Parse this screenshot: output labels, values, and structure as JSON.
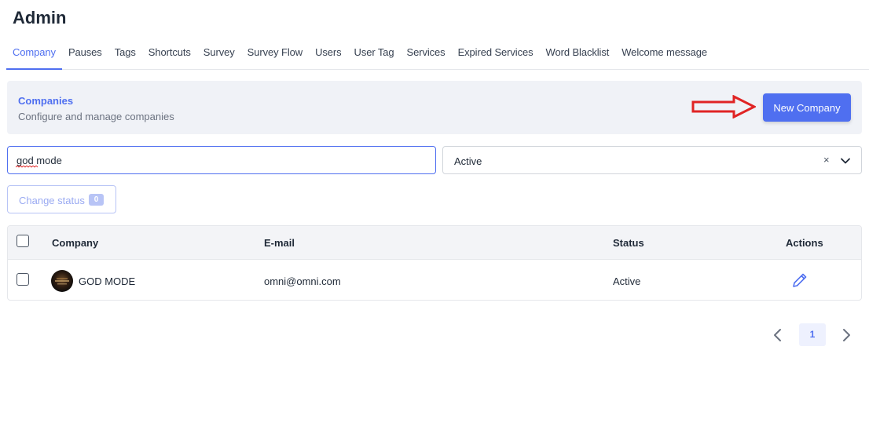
{
  "page": {
    "title": "Admin"
  },
  "tabs": [
    {
      "label": "Company",
      "active": true
    },
    {
      "label": "Pauses"
    },
    {
      "label": "Tags"
    },
    {
      "label": "Shortcuts"
    },
    {
      "label": "Survey"
    },
    {
      "label": "Survey Flow"
    },
    {
      "label": "Users"
    },
    {
      "label": "User Tag"
    },
    {
      "label": "Services"
    },
    {
      "label": "Expired Services"
    },
    {
      "label": "Word Blacklist"
    },
    {
      "label": "Welcome message"
    }
  ],
  "header": {
    "title": "Companies",
    "subtitle": "Configure and manage companies",
    "new_button": "New Company",
    "arrow_color": "#e02424"
  },
  "filters": {
    "search_value": "god mode",
    "status_value": "Active",
    "clear_icon": "×"
  },
  "bulk": {
    "change_status_label": "Change status",
    "selected_count": "0"
  },
  "table": {
    "columns": {
      "company": "Company",
      "email": "E-mail",
      "status": "Status",
      "actions": "Actions"
    },
    "rows": [
      {
        "company": "GOD MODE",
        "email": "omni@omni.com",
        "status": "Active",
        "checked": false
      }
    ]
  },
  "pagination": {
    "current_page": "1"
  },
  "colors": {
    "accent": "#4f6ff0",
    "accent_light": "#b8c4f6",
    "header_bg": "#f0f2f7"
  }
}
